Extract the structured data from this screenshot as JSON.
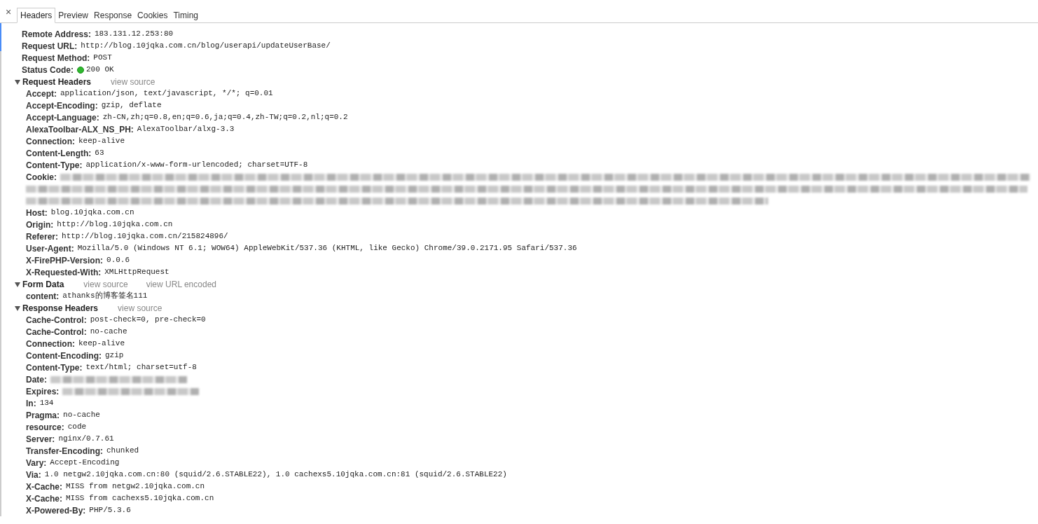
{
  "close": "×",
  "tabs": [
    {
      "label": "Headers",
      "selected": true
    },
    {
      "label": "Preview",
      "selected": false
    },
    {
      "label": "Response",
      "selected": false
    },
    {
      "label": "Cookies",
      "selected": false
    },
    {
      "label": "Timing",
      "selected": false
    }
  ],
  "general": [
    {
      "name": "Remote Address:",
      "value": "183.131.12.253:80"
    },
    {
      "name": "Request URL:",
      "value": "http://blog.10jqka.com.cn/blog/userapi/updateUserBase/"
    },
    {
      "name": "Request Method:",
      "value": "POST"
    },
    {
      "name": "Status Code:",
      "value": "200 OK",
      "kind": "status"
    }
  ],
  "sections": [
    {
      "title": "Request Headers",
      "expanded": true,
      "links": [
        "view source"
      ],
      "headers": [
        {
          "name": "Accept:",
          "value": "application/json, text/javascript, */*; q=0.01"
        },
        {
          "name": "Accept-Encoding:",
          "value": "gzip, deflate"
        },
        {
          "name": "Accept-Language:",
          "value": "zh-CN,zh;q=0.8,en;q=0.6,ja;q=0.4,zh-TW;q=0.2,nl;q=0.2"
        },
        {
          "name": "AlexaToolbar-ALX_NS_PH:",
          "value": "AlexaToolbar/alxg-3.3"
        },
        {
          "name": "Connection:",
          "value": "keep-alive"
        },
        {
          "name": "Content-Length:",
          "value": "63"
        },
        {
          "name": "Content-Type:",
          "value": "application/x-www-form-urlencoded; charset=UTF-8"
        },
        {
          "name": "Cookie:",
          "kind": "redacted-long"
        },
        {
          "name": "Host:",
          "value": "blog.10jqka.com.cn"
        },
        {
          "name": "Origin:",
          "value": "http://blog.10jqka.com.cn"
        },
        {
          "name": "Referer:",
          "value": "http://blog.10jqka.com.cn/215824896/"
        },
        {
          "name": "User-Agent:",
          "value": "Mozilla/5.0 (Windows NT 6.1; WOW64) AppleWebKit/537.36 (KHTML, like Gecko) Chrome/39.0.2171.95 Safari/537.36"
        },
        {
          "name": "X-FirePHP-Version:",
          "value": "0.0.6"
        },
        {
          "name": "X-Requested-With:",
          "value": "XMLHttpRequest"
        }
      ]
    },
    {
      "title": "Form Data",
      "expanded": true,
      "links": [
        "view source",
        "view URL encoded"
      ],
      "headers": [
        {
          "name": "content:",
          "value": "athanks的博客签名111"
        }
      ]
    },
    {
      "title": "Response Headers",
      "expanded": true,
      "links": [
        "view source"
      ],
      "headers": [
        {
          "name": "Cache-Control:",
          "value": "post-check=0, pre-check=0"
        },
        {
          "name": "Cache-Control:",
          "value": "no-cache"
        },
        {
          "name": "Connection:",
          "value": "keep-alive"
        },
        {
          "name": "Content-Encoding:",
          "value": "gzip"
        },
        {
          "name": "Content-Type:",
          "value": "text/html; charset=utf-8"
        },
        {
          "name": "Date:",
          "kind": "redacted"
        },
        {
          "name": "Expires:",
          "kind": "redacted"
        },
        {
          "name": "In:",
          "value": "134"
        },
        {
          "name": "Pragma:",
          "value": "no-cache"
        },
        {
          "name": "resource:",
          "value": "code"
        },
        {
          "name": "Server:",
          "value": "nginx/0.7.61"
        },
        {
          "name": "Transfer-Encoding:",
          "value": "chunked"
        },
        {
          "name": "Vary:",
          "value": "Accept-Encoding"
        },
        {
          "name": "Via:",
          "value": "1.0 netgw2.10jqka.com.cn:80 (squid/2.6.STABLE22), 1.0 cachexs5.10jqka.com.cn:81 (squid/2.6.STABLE22)"
        },
        {
          "name": "X-Cache:",
          "value": "MISS from netgw2.10jqka.com.cn"
        },
        {
          "name": "X-Cache:",
          "value": "MISS from cachexs5.10jqka.com.cn"
        },
        {
          "name": "X-Powered-By:",
          "value": "PHP/5.3.6"
        }
      ]
    }
  ]
}
